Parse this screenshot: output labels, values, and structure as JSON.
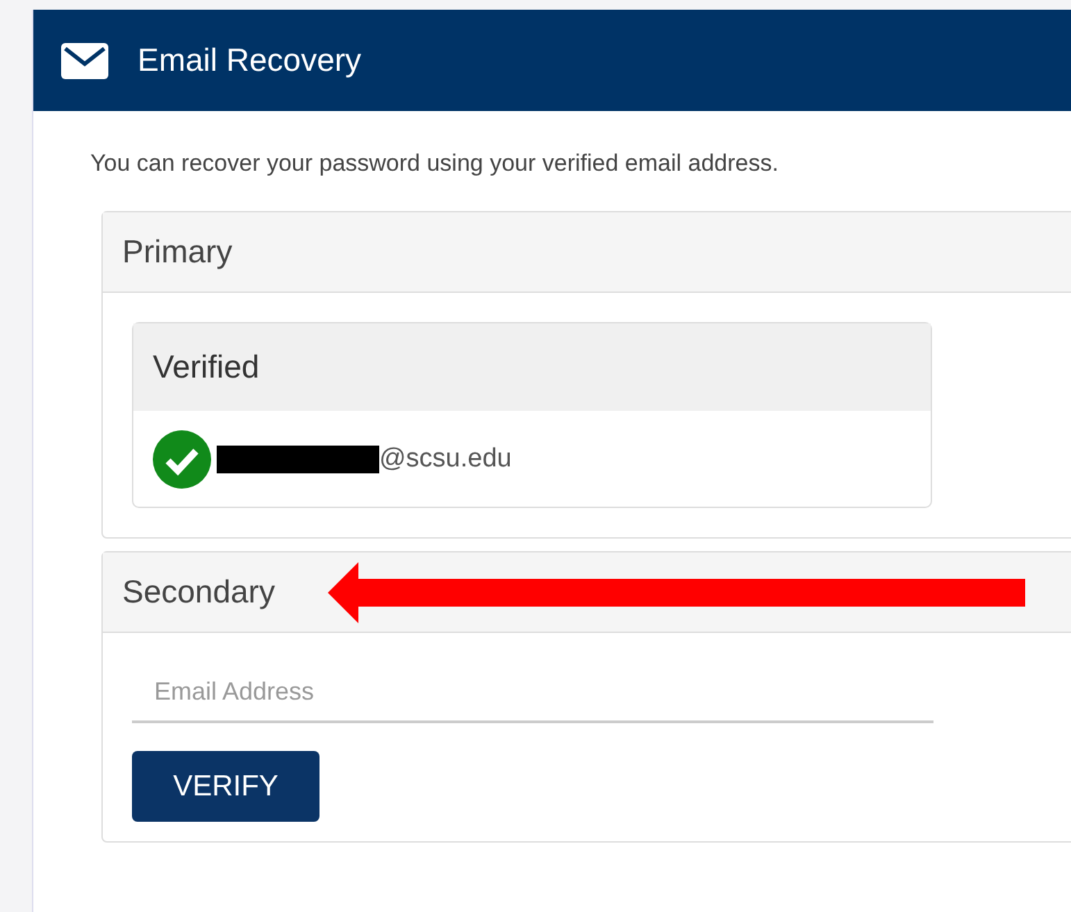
{
  "header": {
    "title": "Email Recovery"
  },
  "intro": "You can recover your password using your verified email address.",
  "primary": {
    "title": "Primary",
    "status": {
      "title": "Verified",
      "verified": true,
      "redacted": true,
      "email": "@scsu.edu"
    }
  },
  "secondary": {
    "title": "Secondary",
    "email_field": {
      "placeholder": "Email Address"
    },
    "button": "VERIFY"
  },
  "annotation": {
    "kind": "arrow"
  }
}
